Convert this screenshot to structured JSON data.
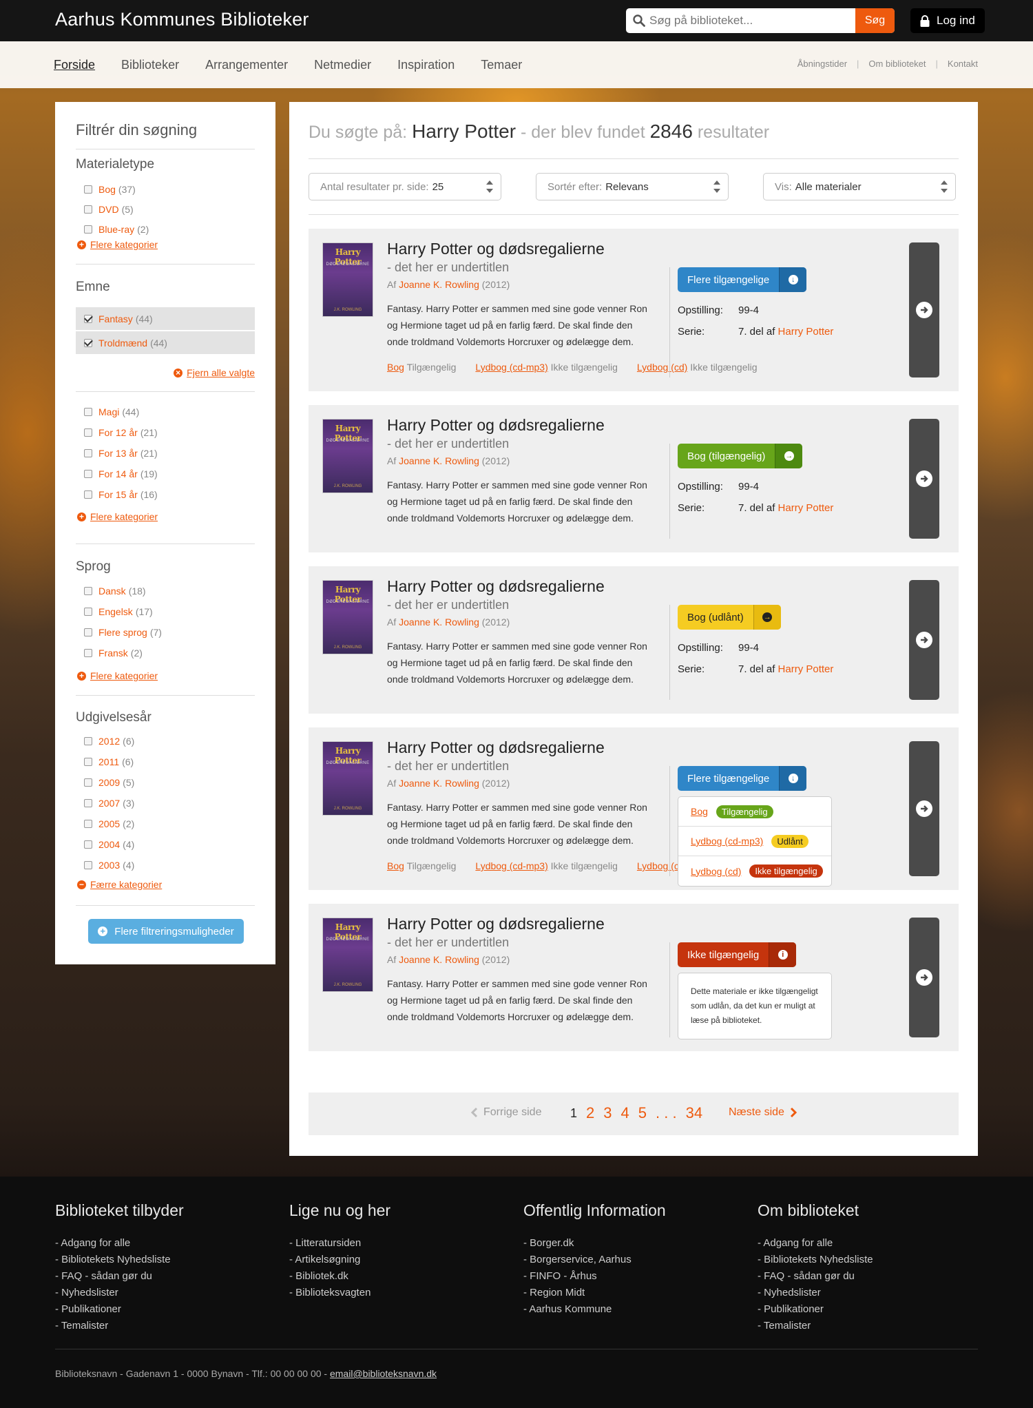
{
  "site_title": "Aarhus Kommunes Biblioteker",
  "search": {
    "placeholder": "Søg på biblioteket...",
    "button": "Søg"
  },
  "login": "Log ind",
  "nav": {
    "items": [
      "Forside",
      "Biblioteker",
      "Arrangementer",
      "Netmedier",
      "Inspiration",
      "Temaer"
    ],
    "util": [
      "Åbningstider",
      "Om biblioteket",
      "Kontakt"
    ]
  },
  "sidebar": {
    "title": "Filtrér din søgning",
    "materialetype": {
      "title": "Materialetype",
      "items": [
        {
          "label": "Bog",
          "count": "(37)"
        },
        {
          "label": "DVD",
          "count": "(5)"
        },
        {
          "label": "Blue-ray",
          "count": "(2)"
        }
      ],
      "more": "Flere kategorier"
    },
    "emne": {
      "title": "Emne",
      "selected": [
        {
          "label": "Fantasy",
          "count": "(44)"
        },
        {
          "label": "Troldmænd",
          "count": "(44)"
        }
      ],
      "remove": "Fjern alle valgte",
      "items": [
        {
          "label": "Magi",
          "count": "(44)"
        },
        {
          "label": "For 12 år",
          "count": "(21)"
        },
        {
          "label": "For 13 år",
          "count": "(21)"
        },
        {
          "label": "For 14 år",
          "count": "(19)"
        },
        {
          "label": "For 15 år",
          "count": "(16)"
        }
      ],
      "more": "Flere kategorier"
    },
    "sprog": {
      "title": "Sprog",
      "items": [
        {
          "label": "Dansk",
          "count": "(18)"
        },
        {
          "label": "Engelsk",
          "count": "(17)"
        },
        {
          "label": "Flere sprog",
          "count": "(7)"
        },
        {
          "label": "Fransk",
          "count": "(2)"
        }
      ],
      "more": "Flere kategorier"
    },
    "aar": {
      "title": "Udgivelsesår",
      "items": [
        {
          "label": "2012",
          "count": "(6)"
        },
        {
          "label": "2011",
          "count": "(6)"
        },
        {
          "label": "2009",
          "count": "(5)"
        },
        {
          "label": "2007",
          "count": "(3)"
        },
        {
          "label": "2005",
          "count": "(2)"
        },
        {
          "label": "2004",
          "count": "(4)"
        },
        {
          "label": "2003",
          "count": "(4)"
        }
      ],
      "less": "Færre kategorier"
    },
    "filter_button": "Flere filtreringsmuligheder"
  },
  "main": {
    "heading": {
      "prefix": "Du søgte på:",
      "query": "Harry Potter",
      "mid": "- der blev fundet",
      "count": "2846",
      "suffix": "resultater"
    },
    "selects": [
      {
        "label": "Antal resultater pr. side:",
        "value": "25"
      },
      {
        "label": "Sortér efter:",
        "value": "Relevans"
      },
      {
        "label": "Vis:",
        "value": "Alle materialer"
      }
    ],
    "book": {
      "cover_title": "Harry Potter",
      "cover_sub": "DØDSREGALIERNE",
      "cover_author": "J.K. ROWLING",
      "title": "Harry Potter og dødsregalierne",
      "subtitle": "- det her er undertitlen",
      "by": "Af",
      "author": "Joanne K. Rowling",
      "year": "(2012)",
      "desc": "Fantasy. Harry Potter er sammen med sine gode venner Ron og Hermione taget ud på en farlig færd. De skal finde den onde troldmand Voldemorts Horcruxer og ødelægge dem.",
      "opst_label": "Opstilling:",
      "opst": "99-4",
      "serie_label": "Serie:",
      "serie": "7. del af",
      "serie_link": "Harry Potter",
      "avail": [
        {
          "type": "Bog",
          "status": "Tilgængelig"
        },
        {
          "type": "Lydbog (cd-mp3)",
          "status": "Ikke tilgængelig"
        },
        {
          "type": "Lydbog (cd)",
          "status": "Ikke tilgængelig"
        }
      ]
    },
    "results": [
      {
        "status": "Flere tilgængelige"
      },
      {
        "status": "Bog (tilgængelig)"
      },
      {
        "status": "Bog (udlånt)"
      },
      {
        "status": "Flere tilgængelige",
        "popup": [
          {
            "type": "Bog",
            "tag": "Tilgængelig"
          },
          {
            "type": "Lydbog (cd-mp3)",
            "tag": "Udlånt"
          },
          {
            "type": "Lydbog (cd)",
            "tag": "Ikke tilgængelig"
          }
        ]
      },
      {
        "status": "Ikke tilgængelig",
        "info": "Dette materiale er ikke tilgængeligt som udlån, da det kun er muligt at læse på biblioteket."
      }
    ],
    "pager": {
      "prev": "Forrige side",
      "pages": [
        "1",
        "2",
        "3",
        "4",
        "5",
        ". . .",
        "34"
      ],
      "next": "Næste side"
    }
  },
  "footer": {
    "cols": [
      {
        "title": "Biblioteket tilbyder",
        "items": [
          "Adgang for alle",
          "Bibliotekets Nyhedsliste",
          "FAQ - sådan gør du",
          "Nyhedslister",
          "Publikationer",
          "Temalister"
        ]
      },
      {
        "title": "Lige nu og her",
        "items": [
          "Litteratursiden",
          "Artikelsøgning",
          "Bibliotek.dk",
          "Biblioteksvagten"
        ]
      },
      {
        "title": "Offentlig Information",
        "items": [
          "Borger.dk",
          "Borgerservice, Aarhus",
          "FINFO - Århus",
          "Region Midt",
          "Aarhus Kommune"
        ]
      },
      {
        "title": "Om biblioteket",
        "items": [
          "Adgang for alle",
          "Bibliotekets Nyhedsliste",
          "FAQ - sådan gør du",
          "Nyhedslister",
          "Publikationer",
          "Temalister"
        ]
      }
    ],
    "address": "Biblioteksnavn - Gadenavn 1 - 0000 Bynavn - Tlf.: 00 00 00 00 -",
    "email": "email@biblioteksnavn.dk"
  },
  "colors": {
    "accent": "#ee5a0e",
    "blue": "#2f86c8",
    "green": "#67a51a",
    "yellow": "#f5cc22",
    "red": "#c5340d"
  }
}
